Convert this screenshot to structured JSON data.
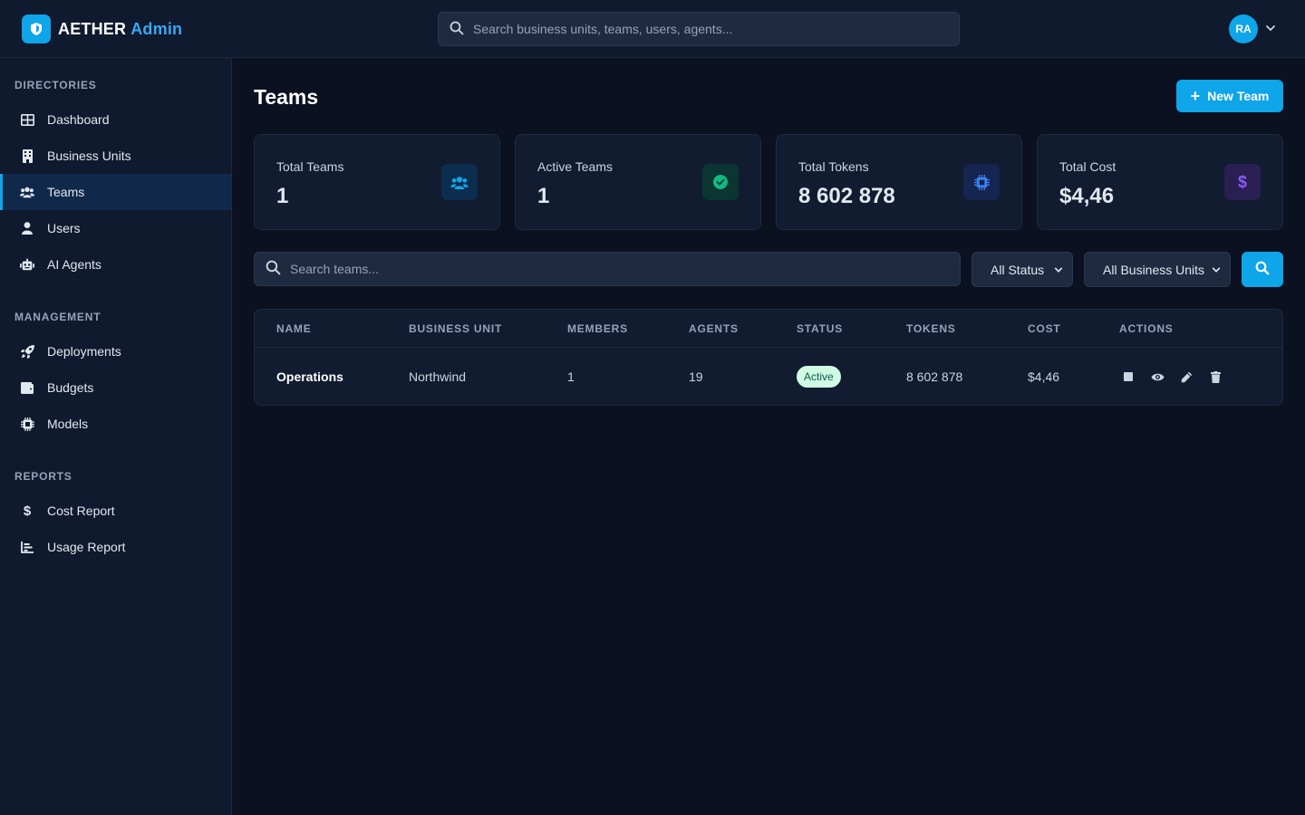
{
  "brand": {
    "name": "AETHER",
    "accent": "Admin"
  },
  "global_search": {
    "placeholder": "Search business units, teams, users, agents..."
  },
  "user": {
    "initials": "RA"
  },
  "sidebar": {
    "sections": [
      {
        "title": "DIRECTORIES",
        "items": [
          {
            "label": "Dashboard",
            "icon": "grid-icon"
          },
          {
            "label": "Business Units",
            "icon": "building-icon"
          },
          {
            "label": "Teams",
            "icon": "users-icon",
            "active": true
          },
          {
            "label": "Users",
            "icon": "user-icon"
          },
          {
            "label": "AI Agents",
            "icon": "robot-icon"
          }
        ]
      },
      {
        "title": "MANAGEMENT",
        "items": [
          {
            "label": "Deployments",
            "icon": "rocket-icon"
          },
          {
            "label": "Budgets",
            "icon": "wallet-icon"
          },
          {
            "label": "Models",
            "icon": "chip-icon"
          }
        ]
      },
      {
        "title": "REPORTS",
        "items": [
          {
            "label": "Cost Report",
            "icon": "dollar-icon"
          },
          {
            "label": "Usage Report",
            "icon": "bar-chart-icon"
          }
        ]
      }
    ]
  },
  "page": {
    "title": "Teams",
    "new_button": "New Team"
  },
  "stats": [
    {
      "label": "Total Teams",
      "value": "1",
      "icon": "users-icon",
      "color": "#0ea5e9"
    },
    {
      "label": "Active Teams",
      "value": "1",
      "icon": "check-circle-icon",
      "color": "#10b981"
    },
    {
      "label": "Total Tokens",
      "value": "8 602 878",
      "icon": "chip-icon",
      "color": "#3b82f6"
    },
    {
      "label": "Total Cost",
      "value": "$4,46",
      "icon": "dollar-icon",
      "color": "#8b5cf6"
    }
  ],
  "filters": {
    "search_placeholder": "Search teams...",
    "status": "All Status",
    "business_units": "All Business Units"
  },
  "table": {
    "columns": [
      "NAME",
      "BUSINESS UNIT",
      "MEMBERS",
      "AGENTS",
      "STATUS",
      "TOKENS",
      "COST",
      "ACTIONS"
    ],
    "rows": [
      {
        "name": "Operations",
        "business_unit": "Northwind",
        "members": "1",
        "agents": "19",
        "status": "Active",
        "tokens": "8 602 878",
        "cost": "$4,46"
      }
    ]
  }
}
